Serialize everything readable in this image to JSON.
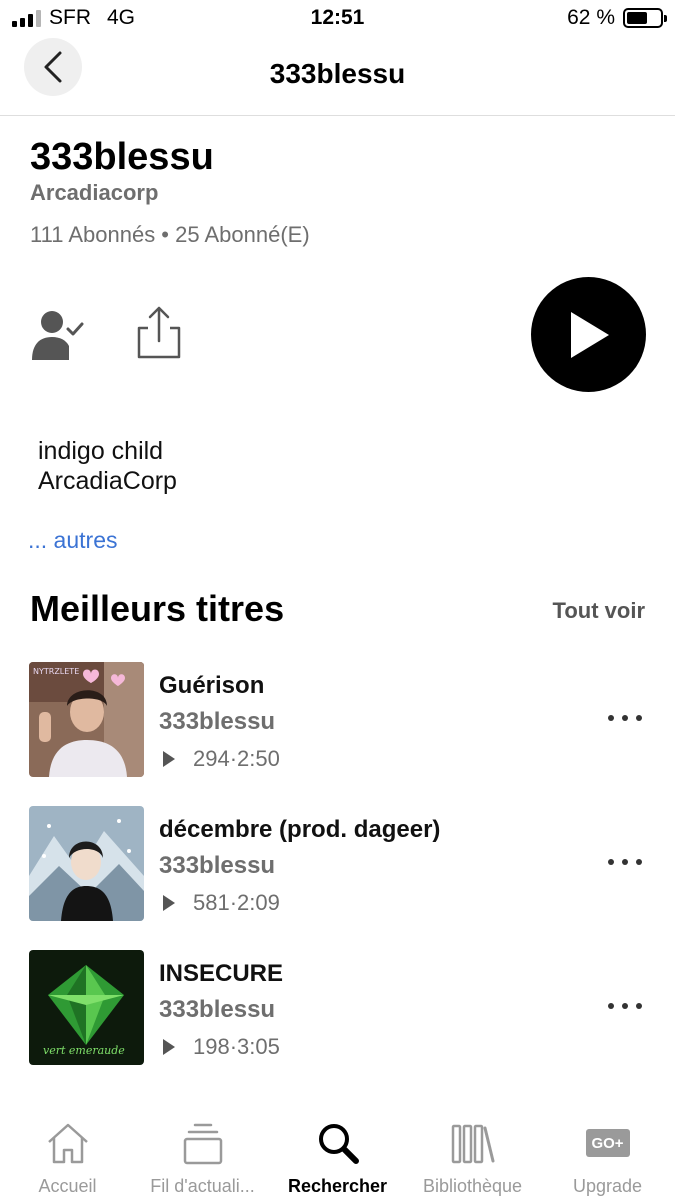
{
  "status_bar": {
    "carrier": "SFR",
    "network": "4G",
    "time": "12:51",
    "battery": "62 %",
    "battery_level": 0.62
  },
  "header": {
    "title": "333blessu",
    "back_icon": "chevron-left-icon"
  },
  "profile": {
    "name": "333blessu",
    "subtitle": "Arcadiacorp",
    "followers": "111 Abonnés • 25 Abonné(E)",
    "bio_line1": "indigo child",
    "bio_line2": "ArcadiaCorp",
    "more_link": "... autres"
  },
  "top_tracks": {
    "title": "Meilleurs titres",
    "see_all": "Tout voir",
    "items": [
      {
        "title": "Guérison",
        "artist": "333blessu",
        "plays": "294",
        "duration": "2:50"
      },
      {
        "title": "décembre (prod. dageer)",
        "artist": "333blessu",
        "plays": "581",
        "duration": "2:09"
      },
      {
        "title": "INSECURE",
        "artist": "333blessu",
        "plays": "198",
        "duration": "3:05"
      }
    ]
  },
  "bottom_nav": {
    "items": [
      {
        "label": "Accueil",
        "icon": "home-icon"
      },
      {
        "label": "Fil d'actuali...",
        "icon": "feed-icon"
      },
      {
        "label": "Rechercher",
        "icon": "search-icon"
      },
      {
        "label": "Bibliothèque",
        "icon": "library-icon"
      },
      {
        "label": "Upgrade",
        "icon": "go-plus-icon",
        "badge": "GO+"
      }
    ]
  }
}
